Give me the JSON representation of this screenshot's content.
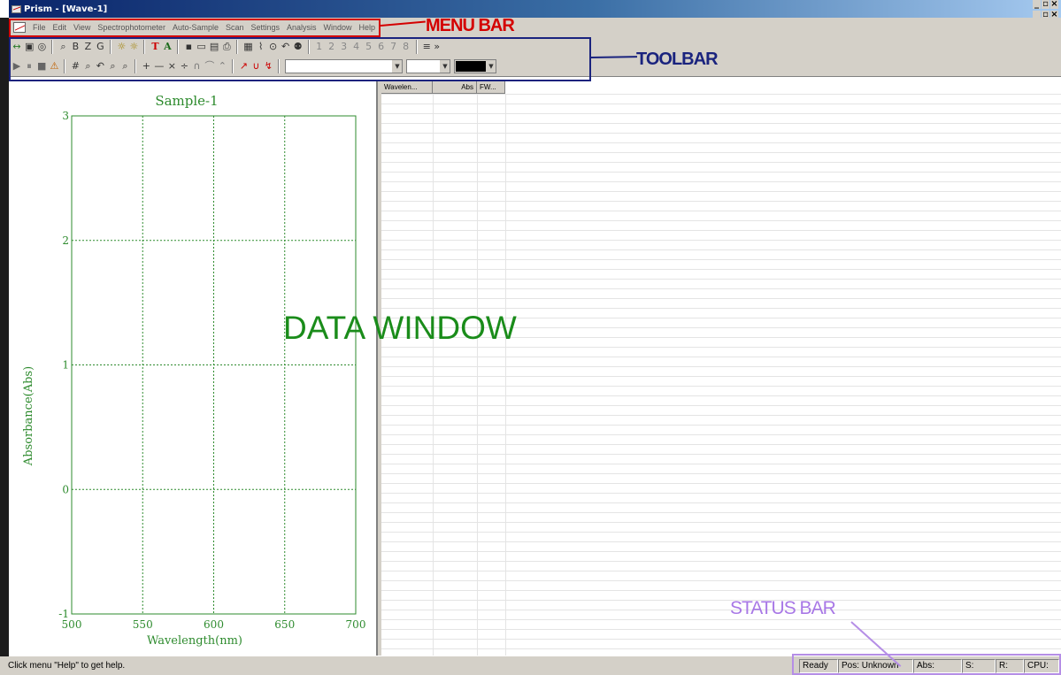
{
  "window": {
    "title": "Prism - [Wave-1]"
  },
  "menubar": {
    "items": [
      "File",
      "Edit",
      "View",
      "Spectrophotometer",
      "Auto-Sample",
      "Scan",
      "Settings",
      "Analysis",
      "Window",
      "Help"
    ]
  },
  "toolbar1": {
    "group1": [
      "↔",
      "▣",
      "◎"
    ],
    "group2": [
      "⌕",
      "B",
      "Z",
      "G"
    ],
    "group3": [
      "☼",
      "☼"
    ],
    "group4": [
      "T",
      "A"
    ],
    "group5": [
      "▪",
      "▭",
      "▤",
      "⎙"
    ],
    "group6": [
      "▦",
      "⌇",
      "⊙",
      "↶",
      "⚉"
    ],
    "channels": [
      "1",
      "2",
      "3",
      "4",
      "5",
      "6",
      "7",
      "8"
    ],
    "more": "≡ »"
  },
  "toolbar2": {
    "playback": [
      "▶",
      "⏸",
      "■",
      "⚠"
    ],
    "zoom": [
      "#",
      "⌕",
      "↶",
      "⌕",
      "⌕"
    ],
    "ops": [
      "+",
      "—",
      "×",
      "÷",
      "∩",
      "⌒",
      "⌃"
    ],
    "peaks": [
      "↗",
      "∪",
      "↯"
    ],
    "combo1_value": "",
    "combo2_value": "",
    "color_value": "#000000"
  },
  "chart_data": {
    "type": "line",
    "title": "Sample-1",
    "xlabel": "Wavelength(nm)",
    "ylabel": "Absorbance(Abs)",
    "xlim": [
      500,
      700
    ],
    "ylim": [
      -1,
      3
    ],
    "x_ticks": [
      500,
      550,
      600,
      650,
      700
    ],
    "y_ticks": [
      -1,
      0,
      1,
      2,
      3
    ],
    "grid": true,
    "series": [],
    "color": "#2e8b2e"
  },
  "grid": {
    "columns": [
      "Wavelen...",
      "Abs",
      "FW..."
    ],
    "rows": []
  },
  "statusbar": {
    "help": "Click menu \"Help\" to get help.",
    "ready": "Ready",
    "pos": "Pos: Unknown",
    "abs": "Abs:",
    "s": "S:",
    "r": "R:",
    "cpu": "CPU:"
  },
  "annotations": {
    "menu_bar": "MENU BAR",
    "toolbar": "TOOLBAR",
    "data_window": "DATA WINDOW",
    "status_bar": "STATUS BAR"
  }
}
